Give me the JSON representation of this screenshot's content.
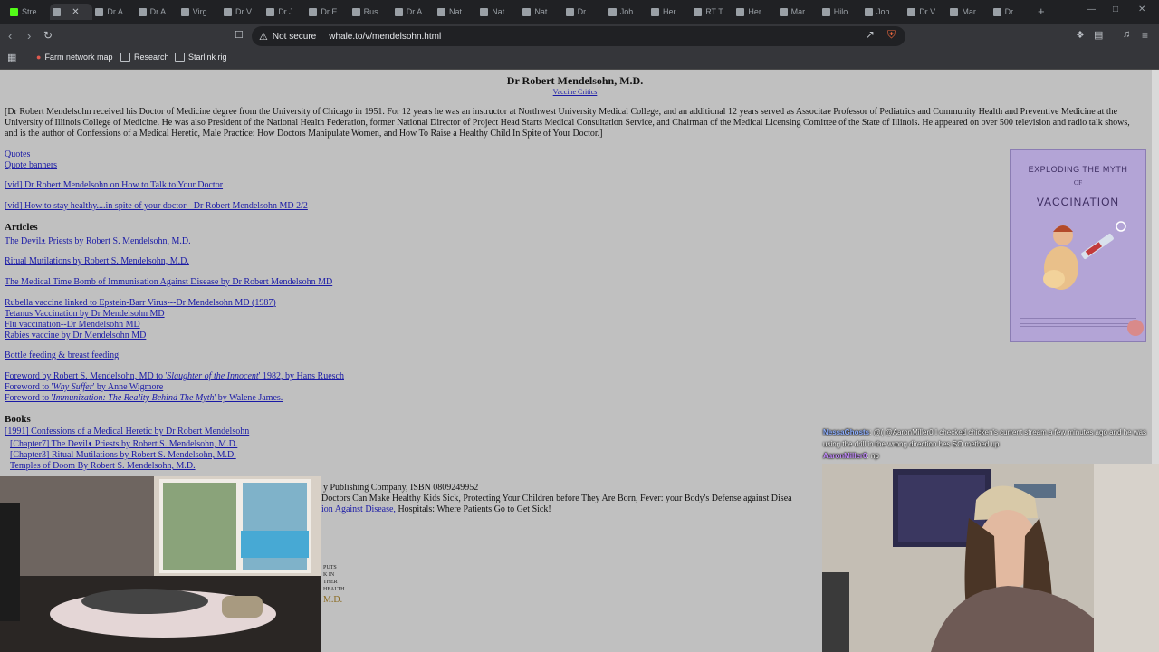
{
  "browser": {
    "tabs": [
      {
        "label": "Stre"
      },
      {
        "label": ""
      },
      {
        "label": "Dr A"
      },
      {
        "label": "Dr A"
      },
      {
        "label": "Virg"
      },
      {
        "label": "Dr V"
      },
      {
        "label": "Dr J"
      },
      {
        "label": "Dr E"
      },
      {
        "label": "Rus"
      },
      {
        "label": "Dr A"
      },
      {
        "label": "Nat"
      },
      {
        "label": "Nat"
      },
      {
        "label": "Nat"
      },
      {
        "label": "Dr."
      },
      {
        "label": "Joh"
      },
      {
        "label": "Her"
      },
      {
        "label": "RT T"
      },
      {
        "label": "Her"
      },
      {
        "label": "Mar"
      },
      {
        "label": "Hilo"
      },
      {
        "label": "Joh"
      },
      {
        "label": "Dr V"
      },
      {
        "label": "Mar"
      },
      {
        "label": "Dr."
      }
    ],
    "security": "Not secure",
    "url": "whale.to/v/mendelsohn.html",
    "bookmarks": [
      "Farm network map",
      "Research",
      "Starlink rig"
    ]
  },
  "page": {
    "title": "Dr Robert Mendelsohn, M.D.",
    "subtitle": "Vaccine Critics",
    "intro": "[Dr Robert Mendelsohn received his Doctor of Medicine degree from the University of Chicago in 1951.  For 12 years he was an instructor at Northwest University Medical College, and an additional 12 years served as Associtae Professor of Pediatrics and Community Health and Preventive Medicine at the University of Illinois College of Medicine.  He was also President of the National Health Federation, former National Director of Project Head Starts Medical Consultation Service, and Chairman of the Medical Licensing Comittee of the State of Illinois.  He appeared on over 500 television and radio talk shows, and is the author of Confessions of a Medical Heretic, Male Practice: How Doctors Manipulate Women, and How To Raise a Healthy Child In Spite of Your Doctor.]",
    "links_top": [
      "Quotes",
      "Quote banners"
    ],
    "videos": [
      "[vid] Dr Robert Mendelsohn on How to Talk to Your Doctor",
      "[vid] How to stay healthy....in spite of your doctor - Dr Robert Mendelsohn MD 2/2"
    ],
    "articles_heading": "Articles",
    "articles": [
      "The Devilᴥ Priests by Robert S. Mendelsohn, M.D.",
      "Ritual Mutilations by Robert S. Mendelsohn, M.D.",
      "The Medical Time Bomb of Immunisation Against Disease by Dr Robert Mendelsohn MD",
      "Rubella vaccine linked to Epstein-Barr Virus---Dr Mendelsohn MD (1987)",
      "Tetanus Vaccination by Dr Mendelsohn MD",
      "Flu vaccination--Dr Mendelsohn MD",
      "Rabies vaccine by Dr Mendelsohn MD",
      "Bottle feeding & breast feeding"
    ],
    "forewords": [
      {
        "pre": "Foreword by Robert S. Mendelsohn, MD to '",
        "em": "Slaughter of the Innocent",
        "post": "' 1982, by Hans Ruesch"
      },
      {
        "pre": "Foreword to '",
        "em": "Why Suffer",
        "post": "' by Anne Wigmore"
      },
      {
        "pre": "Foreword to '",
        "em": "Immunization: The Reality Behind The Myth",
        "post": "' by Walene James."
      }
    ],
    "books_heading": "Books",
    "books": [
      "[1991] Confessions of a Medical Heretic by Dr Robert Mendelsohn",
      "[Chapter7] The Devilᴥ Priests by Robert S. Mendelsohn, M.D.",
      "[Chapter3] Ritual Mutilations by Robert S. Mendelsohn, M.D.",
      "Temples of Doom By Robert S. Mendelsohn, M.D."
    ],
    "partial_1": "y Publishing Company, ISBN 0809249952",
    "partial_2": "Doctors Can Make Healthy Kids Sick, Protecting Your Children before They Are Born, Fever: your Body's Defense against Disea",
    "partial_3a": "ion Against Disease,",
    "partial_3b": " Hospitals: Where Patients Go to Get Sick!",
    "book_cover": {
      "line1": "EXPLODING THE MYTH",
      "line2": "OF",
      "line3": "VACCINATION"
    },
    "book_snippet": [
      "PUTS",
      "K IN",
      "THER",
      "HEALTH",
      "M.D."
    ]
  },
  "chat": [
    {
      "user": "NessaGhosts",
      "text": ": @( @AaronMiller0 I checked chicken's current stream a few minutes ago and he was using the drill in the wrong direction hes SO methed up"
    },
    {
      "user": "AaronMiller0",
      "text": ": np"
    }
  ],
  "colors": {
    "link": "#1a1aa6",
    "page_bg": "#c0c0c0",
    "chrome_bg": "#202124"
  }
}
